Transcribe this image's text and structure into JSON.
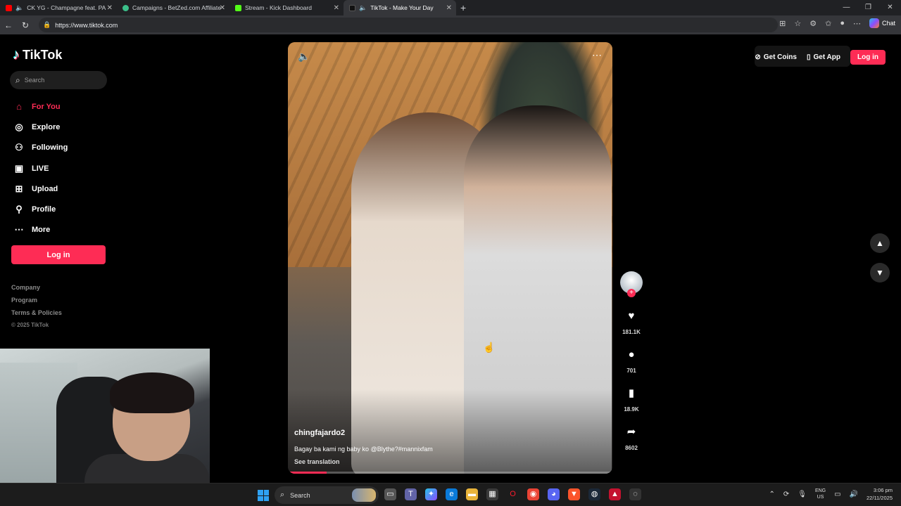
{
  "browser": {
    "tabs": [
      {
        "title": "CK YG - Champagne feat. PA",
        "favicon_color": "#ff0000"
      },
      {
        "title": "Campaigns - BetZed.com Affiliate",
        "favicon_color": "#3bbf8a"
      },
      {
        "title": "Stream - Kick Dashboard",
        "favicon_color": "#53fc18"
      },
      {
        "title": "TikTok - Make Your Day",
        "favicon_color": "#111111"
      }
    ],
    "active_tab": 3,
    "url": "https://www.tiktok.com",
    "chat_label": "Chat"
  },
  "sidebar": {
    "logo_text": "TikTok",
    "search_placeholder": "Search",
    "nav": [
      {
        "label": "For You",
        "icon": "home-icon",
        "active": true
      },
      {
        "label": "Explore",
        "icon": "compass-icon"
      },
      {
        "label": "Following",
        "icon": "following-icon"
      },
      {
        "label": "LIVE",
        "icon": "live-icon"
      },
      {
        "label": "Upload",
        "icon": "upload-icon"
      },
      {
        "label": "Profile",
        "icon": "profile-icon"
      },
      {
        "label": "More",
        "icon": "more-icon"
      }
    ],
    "login_label": "Log in",
    "footer": [
      "Company",
      "Program",
      "Terms & Policies"
    ],
    "copyright": "© 2025 TikTok"
  },
  "header": {
    "get_coins": "Get Coins",
    "get_app": "Get App",
    "login": "Log in"
  },
  "video": {
    "author": "chingfajardo2",
    "caption": "Bagay ba kami ng baby ko @Blythe?#mannixfam",
    "see_translation": "See translation",
    "progress": 0.12
  },
  "actions": {
    "likes": "181.1K",
    "comments": "701",
    "saves": "18.9K",
    "shares": "8602"
  },
  "taskbar": {
    "search_label": "Search",
    "lang_top": "ENG",
    "lang_bottom": "US",
    "time": "3:06 pm",
    "date": "22/11/2025"
  }
}
